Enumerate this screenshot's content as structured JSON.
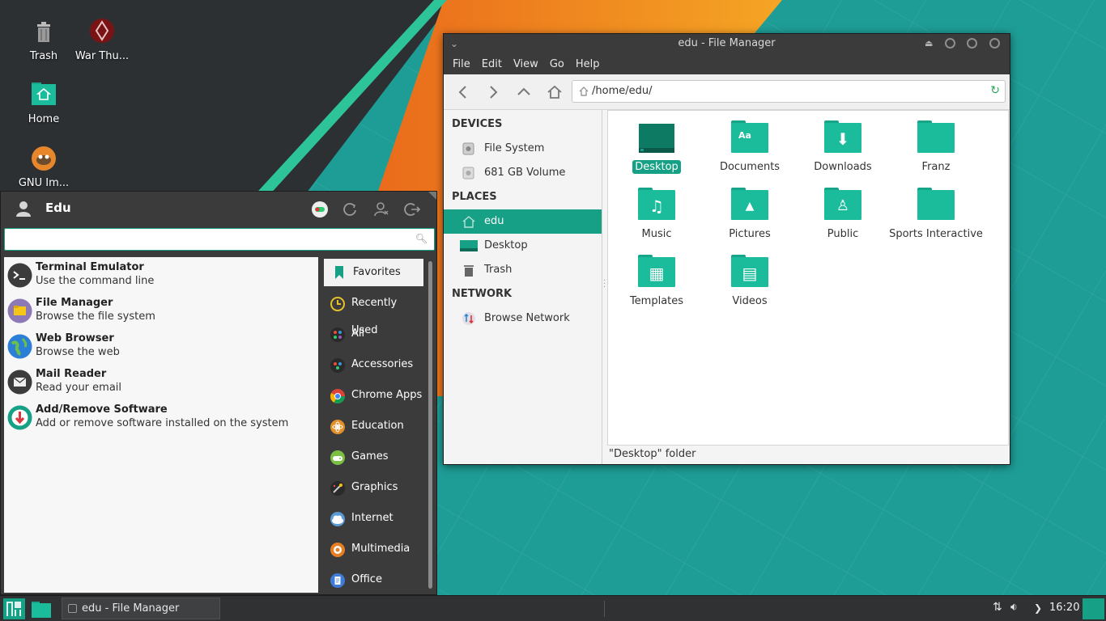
{
  "desktop": {
    "icons": [
      {
        "label": "Trash",
        "icon": "trash-icon"
      },
      {
        "label": "War Thu...",
        "icon": "war-thunder-icon"
      },
      {
        "label": "Home",
        "icon": "home-folder-icon"
      },
      {
        "label": "GNU Im...",
        "icon": "gimp-icon"
      }
    ]
  },
  "file_manager": {
    "title": "edu - File Manager",
    "menu": [
      "File",
      "Edit",
      "View",
      "Go",
      "Help"
    ],
    "path": "/home/edu/",
    "sidebar": {
      "devices_heading": "DEVICES",
      "devices": [
        "File System",
        "681 GB Volume"
      ],
      "places_heading": "PLACES",
      "places": [
        "edu",
        "Desktop",
        "Trash"
      ],
      "network_heading": "NETWORK",
      "network": [
        "Browse Network"
      ]
    },
    "items": [
      "Desktop",
      "Documents",
      "Downloads",
      "Franz",
      "Music",
      "Pictures",
      "Public",
      "Sports Interactive",
      "Templates",
      "Videos"
    ],
    "glyphs": {
      "documents": "Aa",
      "downloads": "⬇",
      "music": "♫",
      "pictures": "▲",
      "public": "♙",
      "templates": "▦",
      "videos": "▤"
    },
    "status": "\"Desktop\" folder"
  },
  "app_menu": {
    "user": "Edu",
    "search_value": "",
    "apps": [
      {
        "title": "Terminal Emulator",
        "desc": "Use the command line"
      },
      {
        "title": "File Manager",
        "desc": "Browse the file system"
      },
      {
        "title": "Web Browser",
        "desc": "Browse the web"
      },
      {
        "title": "Mail Reader",
        "desc": "Read your email"
      },
      {
        "title": "Add/Remove Software",
        "desc": "Add or remove software installed on the system"
      }
    ],
    "categories": [
      "Favorites",
      "Recently Used",
      "All",
      "Accessories",
      "Chrome Apps",
      "Education",
      "Games",
      "Graphics",
      "Internet",
      "Multimedia",
      "Office"
    ]
  },
  "taskbar": {
    "task": "edu - File Manager",
    "clock": "16:20"
  },
  "colors": {
    "accent": "#16a085",
    "folder": "#1abc9c",
    "dark": "#3b3b3b",
    "orange": "#f28b1c"
  }
}
